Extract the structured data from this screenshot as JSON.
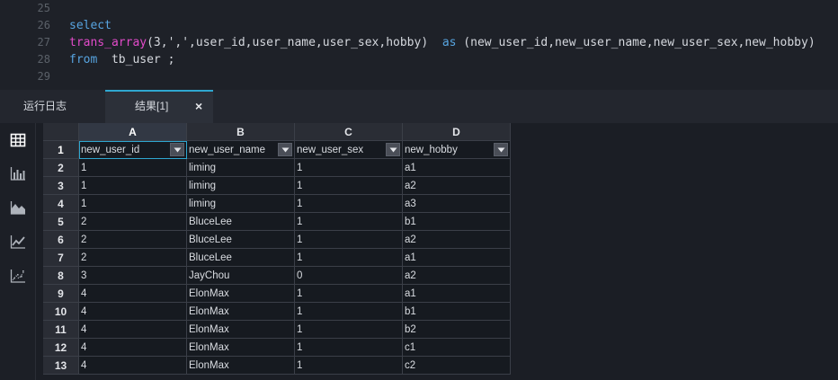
{
  "editor": {
    "lines": [
      {
        "num": "25",
        "tokens": []
      },
      {
        "num": "26",
        "tokens": [
          {
            "t": "select",
            "k": "kw"
          }
        ]
      },
      {
        "num": "27",
        "tokens": [
          {
            "t": "trans_array",
            "k": "fn"
          },
          {
            "t": "(3,',',user_id,user_name,user_sex,hobby)  ",
            "k": ""
          },
          {
            "t": "as",
            "k": "kw"
          },
          {
            "t": " (new_user_id,new_user_name,new_user_sex,new_hobby)",
            "k": ""
          }
        ]
      },
      {
        "num": "28",
        "tokens": [
          {
            "t": "from",
            "k": "kw"
          },
          {
            "t": "  tb_user ;",
            "k": ""
          }
        ]
      },
      {
        "num": "29",
        "tokens": []
      }
    ]
  },
  "tabs": {
    "log_label": "运行日志",
    "result_label": "结果[1]",
    "close_glyph": "×"
  },
  "sidebar": {
    "tools": [
      "table-icon",
      "bar-chart-icon",
      "area-chart-icon",
      "line-chart-icon",
      "scatter-chart-icon"
    ]
  },
  "grid": {
    "columns": [
      "A",
      "B",
      "C",
      "D"
    ],
    "header_row_num": "1",
    "headers": [
      "new_user_id",
      "new_user_name",
      "new_user_sex",
      "new_hobby"
    ],
    "rows": [
      {
        "num": "2",
        "cells": [
          "1",
          "liming",
          "1",
          "a1"
        ]
      },
      {
        "num": "3",
        "cells": [
          "1",
          "liming",
          "1",
          "a2"
        ]
      },
      {
        "num": "4",
        "cells": [
          "1",
          "liming",
          "1",
          "a3"
        ]
      },
      {
        "num": "5",
        "cells": [
          "2",
          "BluceLee",
          "1",
          "b1"
        ]
      },
      {
        "num": "6",
        "cells": [
          "2",
          "BluceLee",
          "1",
          "a2"
        ]
      },
      {
        "num": "7",
        "cells": [
          "2",
          "BluceLee",
          "1",
          "a1"
        ]
      },
      {
        "num": "8",
        "cells": [
          "3",
          "JayChou",
          "0",
          "a2"
        ]
      },
      {
        "num": "9",
        "cells": [
          "4",
          "ElonMax",
          "1",
          "a1"
        ]
      },
      {
        "num": "10",
        "cells": [
          "4",
          "ElonMax",
          "1",
          "b1"
        ]
      },
      {
        "num": "11",
        "cells": [
          "4",
          "ElonMax",
          "1",
          "b2"
        ]
      },
      {
        "num": "12",
        "cells": [
          "4",
          "ElonMax",
          "1",
          "c1"
        ]
      },
      {
        "num": "13",
        "cells": [
          "4",
          "ElonMax",
          "1",
          "c2"
        ]
      }
    ]
  }
}
